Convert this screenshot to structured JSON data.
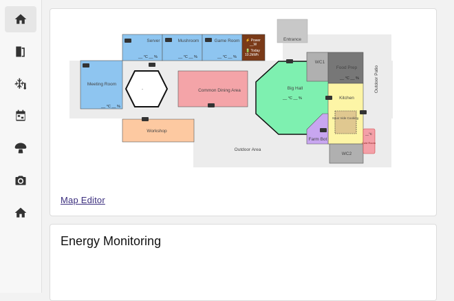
{
  "nav": {
    "items": [
      {
        "name": "home",
        "icon": "home-icon"
      },
      {
        "name": "rooms",
        "icon": "door-icon"
      },
      {
        "name": "climate",
        "icon": "snowflake-thermometer-icon"
      },
      {
        "name": "calendar",
        "icon": "calendar-icon"
      },
      {
        "name": "mushroom",
        "icon": "mushroom-icon"
      },
      {
        "name": "camera",
        "icon": "camera-icon"
      },
      {
        "name": "house",
        "icon": "house-icon"
      }
    ]
  },
  "map": {
    "rooms": {
      "server": "Server",
      "mushroom": "Mushroom",
      "game_room": "Game Room",
      "meeting_room": "Meeting Room",
      "common_dining": "Common Dining Area",
      "workshop": "Workshop",
      "outdoor_area": "Outdoor Area",
      "big_hall": "Big Hall",
      "wc1": "WC1",
      "food_prep": "Food Prep",
      "kitchen": "Kitchen",
      "sous_vide": "Sous Vide Cooking",
      "farm_bot": "Farm Bot",
      "wc2": "WC2",
      "entrance": "Entrance",
      "outdoor_patio": "Outdoor Patio",
      "cold_room": "Cold Room"
    },
    "readings": {
      "server": "__ °C __ %",
      "mushroom": "__ °C __ %",
      "game_room": "__ °C __ %",
      "meeting_room": "__ °C __ %",
      "big_hall": "__ °C __ %",
      "food_prep": "__ °C __ %",
      "cold_room": "__°C",
      "power_label": "⚡ Power",
      "power_value": "__W",
      "today_label": "🔋 Today",
      "today_value": "10.2kWh",
      "hexagon": "-"
    },
    "colors": {
      "blue_room": "#8ec5f0",
      "red_room": "#f4a4a8",
      "orange_room": "#fdc9a1",
      "green_hall": "#7ef0b0",
      "grey_room": "#b0b0b0",
      "dark_room": "#777777",
      "yellow_room": "#fdf5a6",
      "purple_room": "#c8a6f0",
      "pink_room": "#f4a0a8",
      "power_panel": "#7a3a18",
      "area_grey": "#ececec"
    }
  },
  "map_editor_link": "Map Editor",
  "energy": {
    "title": "Energy Monitoring"
  }
}
